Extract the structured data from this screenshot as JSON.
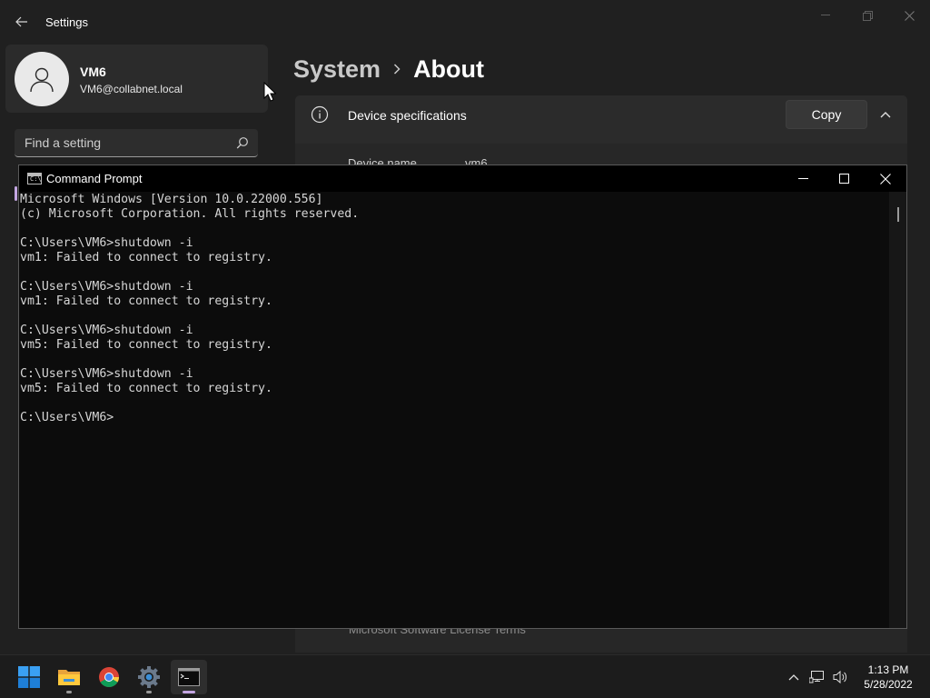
{
  "settings": {
    "title": "Settings",
    "user": {
      "name": "VM6",
      "email": "VM6@collabnet.local"
    },
    "search": {
      "placeholder": "Find a setting"
    },
    "breadcrumb": {
      "parent": "System",
      "current": "About"
    },
    "device_specs": {
      "title": "Device specifications",
      "copy_label": "Copy",
      "rows": [
        {
          "label": "Device name",
          "value": "vm6"
        }
      ],
      "license_link": "Microsoft Software License Terms"
    }
  },
  "cmd": {
    "title": "Command Prompt",
    "lines": [
      "Microsoft Windows [Version 10.0.22000.556]",
      "(c) Microsoft Corporation. All rights reserved.",
      "",
      "C:\\Users\\VM6>shutdown -i",
      "vm1: Failed to connect to registry.",
      "",
      "C:\\Users\\VM6>shutdown -i",
      "vm1: Failed to connect to registry.",
      "",
      "C:\\Users\\VM6>shutdown -i",
      "vm5: Failed to connect to registry.",
      "",
      "C:\\Users\\VM6>shutdown -i",
      "vm5: Failed to connect to registry.",
      "",
      "C:\\Users\\VM6>"
    ]
  },
  "taskbar": {
    "apps": [
      {
        "name": "start-icon"
      },
      {
        "name": "file-explorer-icon"
      },
      {
        "name": "chrome-icon"
      },
      {
        "name": "settings-gear-icon"
      },
      {
        "name": "terminal-icon"
      }
    ],
    "clock": {
      "time": "1:13 PM",
      "date": "5/28/2022"
    }
  },
  "colors": {
    "accent": "#c4a6e2",
    "terminal_bg": "#0c0c0c",
    "settings_bg": "#202020",
    "card_bg": "#2b2b2b"
  }
}
